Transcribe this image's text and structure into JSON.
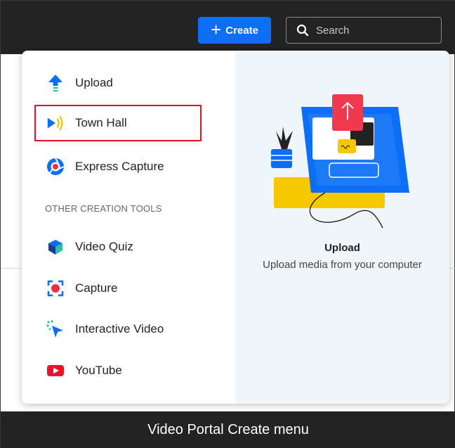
{
  "topbar": {
    "create_label": "Create",
    "search_placeholder": "Search"
  },
  "menu": {
    "items": [
      {
        "label": "Upload",
        "icon": "upload-arrow-icon"
      },
      {
        "label": "Town Hall",
        "icon": "town-hall-broadcast-icon"
      },
      {
        "label": "Express Capture",
        "icon": "express-capture-icon"
      }
    ],
    "section_label": "OTHER CREATION TOOLS",
    "other_items": [
      {
        "label": "Video Quiz",
        "icon": "video-quiz-cube-icon"
      },
      {
        "label": "Capture",
        "icon": "capture-record-icon"
      },
      {
        "label": "Interactive Video",
        "icon": "interactive-video-cursor-icon"
      },
      {
        "label": "YouTube",
        "icon": "youtube-icon"
      }
    ],
    "highlighted_item": "Town Hall"
  },
  "preview": {
    "title": "Upload",
    "description": "Upload media from your computer"
  },
  "caption": "Video Portal Create menu",
  "colors": {
    "accent": "#0b6ef4",
    "topbar": "#232323",
    "highlight_border": "#e0141e",
    "preview_bg": "#f0f5fa"
  }
}
